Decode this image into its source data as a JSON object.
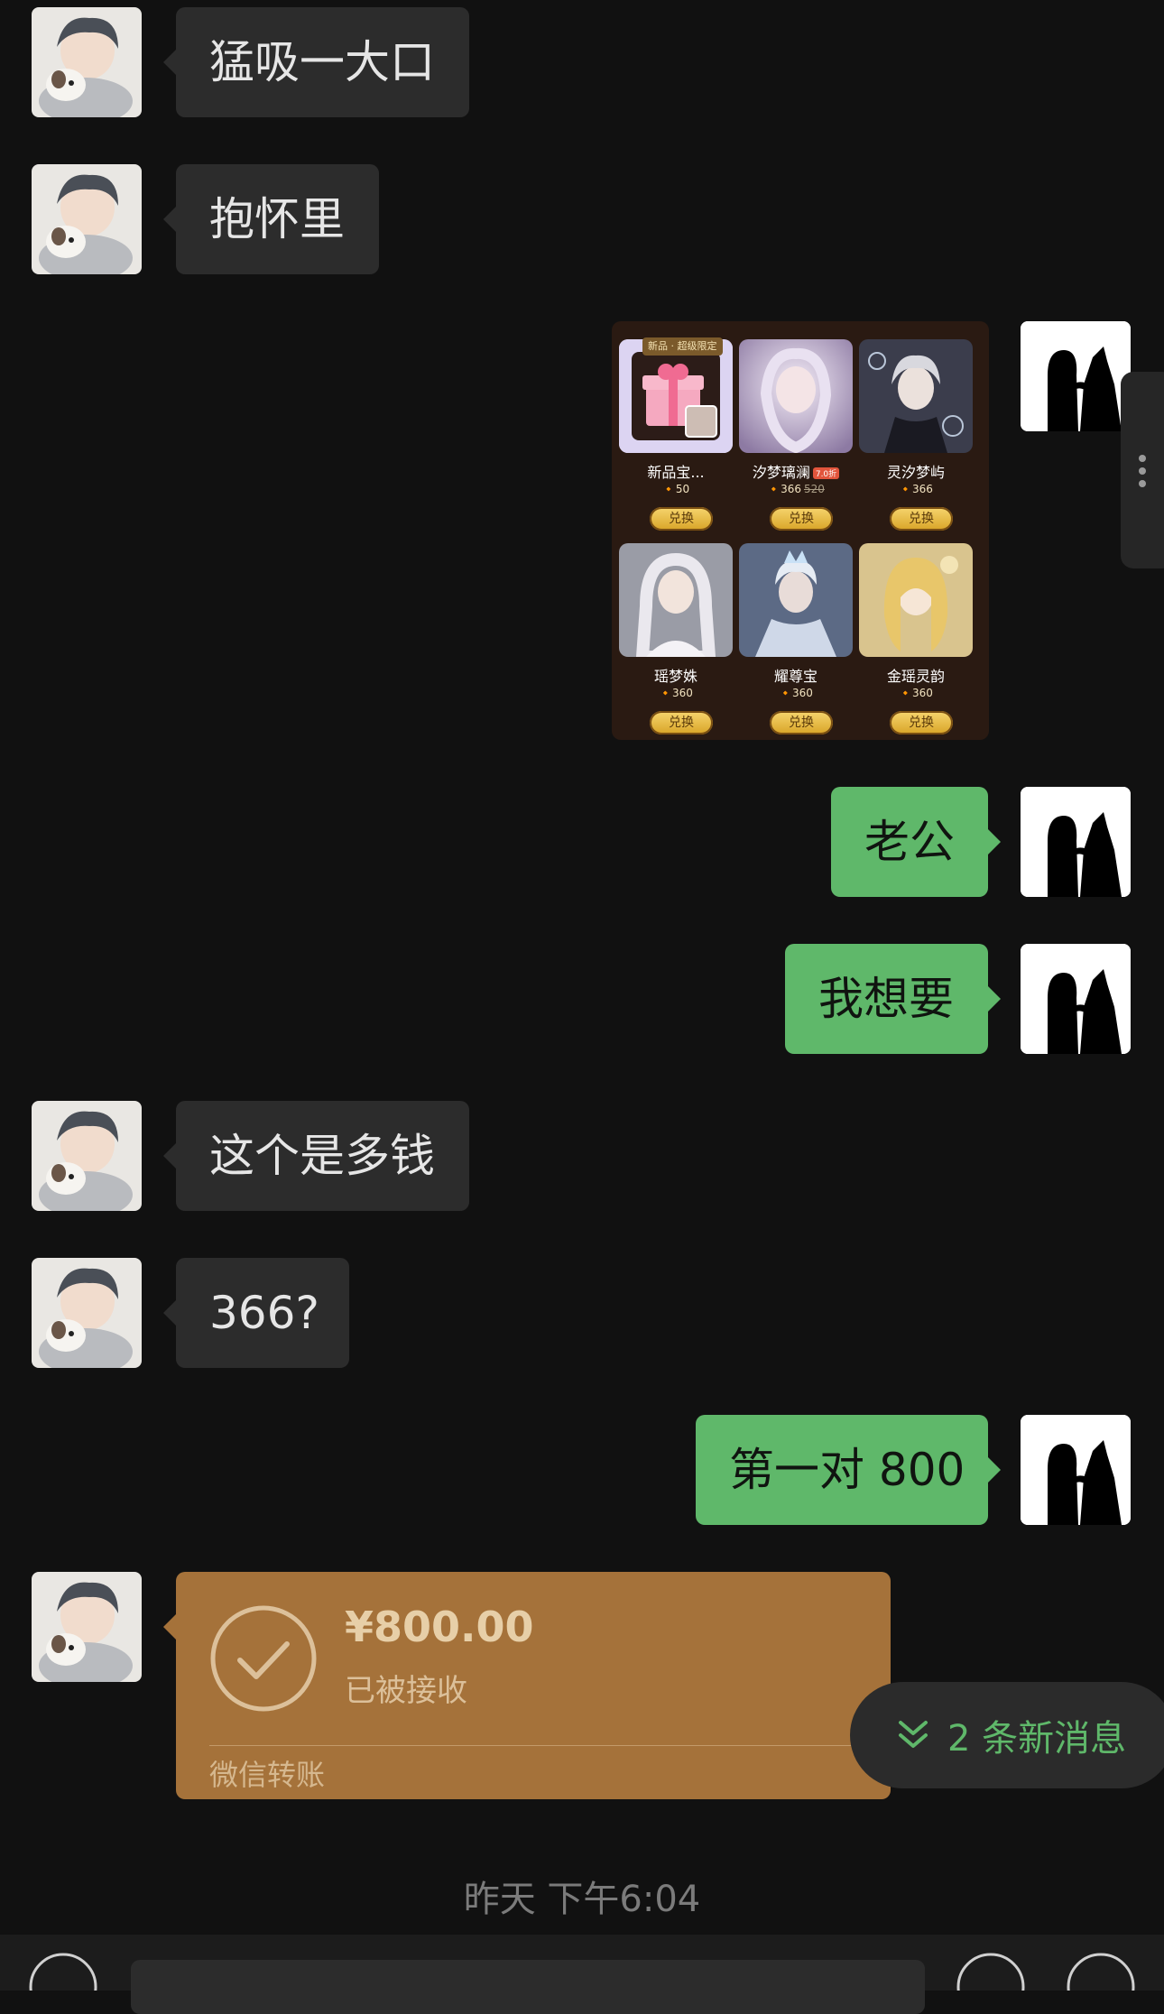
{
  "messages": [
    {
      "side": "in",
      "text": "猛吸一大口"
    },
    {
      "side": "in",
      "text": "抱怀里"
    },
    {
      "side": "out",
      "text": "老公"
    },
    {
      "side": "out",
      "text": "我想要"
    },
    {
      "side": "in",
      "text": "这个是多钱"
    },
    {
      "side": "in",
      "text": "366?"
    },
    {
      "side": "out",
      "text": "第一对 800"
    }
  ],
  "shop": {
    "new_tag": "新品 · 超级限定",
    "exchange_label": "兑换",
    "items": [
      {
        "name": "新品宝...",
        "price": "50"
      },
      {
        "name": "汐梦璃澜",
        "price": "366",
        "old_price": "520",
        "discount": "7.0折"
      },
      {
        "name": "灵汐梦屿",
        "price": "366"
      },
      {
        "name": "瑶梦姝",
        "price": "360"
      },
      {
        "name": "耀尊宝",
        "price": "360"
      },
      {
        "name": "金瑶灵韵",
        "price": "360"
      }
    ]
  },
  "transfer": {
    "amount": "¥800.00",
    "status": "已被接收",
    "label": "微信转账"
  },
  "new_messages": {
    "text": "2 条新消息"
  },
  "timestamp": "昨天 下午6:04",
  "colors": {
    "background": "#111111",
    "incoming": "#2c2c2c",
    "outgoing": "#5fb86a",
    "transfer": "#a5723a"
  }
}
